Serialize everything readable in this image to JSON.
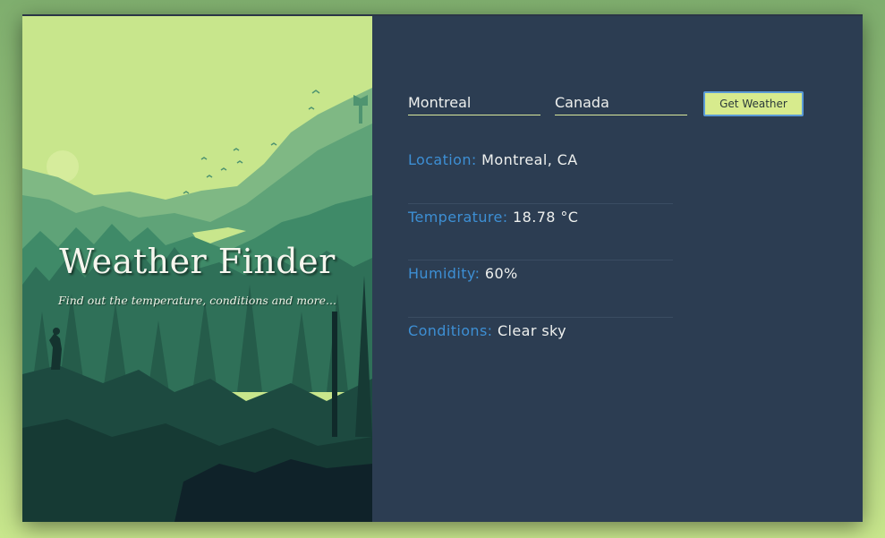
{
  "app": {
    "title": "Weather Finder",
    "subtitle": "Find out the temperature, conditions and more..."
  },
  "form": {
    "city_value": "Montreal",
    "country_value": "Canada",
    "submit_label": "Get Weather"
  },
  "results": {
    "location_label": "Location:",
    "location_value": "Montreal, CA",
    "temperature_label": "Temperature:",
    "temperature_value": "18.78 °C",
    "humidity_label": "Humidity:",
    "humidity_value": "60%",
    "conditions_label": "Conditions:",
    "conditions_value": "Clear sky"
  },
  "colors": {
    "panel_bg": "#2c3d52",
    "accent_key": "#3d8fd4",
    "button_bg": "#d7eb8d",
    "button_border": "#5a9ad6",
    "sky": "#c8e68c"
  }
}
